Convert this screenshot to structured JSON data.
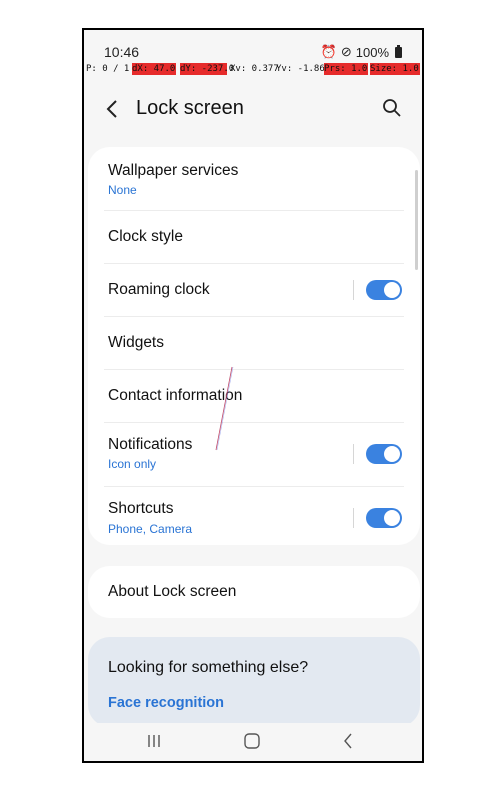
{
  "status": {
    "time": "10:46",
    "battery": "100%",
    "icons": [
      "alarm-icon",
      "do-not-disturb-icon",
      "battery-icon"
    ]
  },
  "debug": {
    "p": "P: 0 / 1",
    "dx": "dX: 47.0",
    "dy": "dY: -237.0",
    "xv": "Xv: 0.377",
    "yv": "Yv: -1.868",
    "prs": "Prs: 1.0",
    "size": "Size: 1.0"
  },
  "header": {
    "title": "Lock screen"
  },
  "settings": {
    "items": [
      {
        "label": "Wallpaper services",
        "sub": "None"
      },
      {
        "label": "Clock style"
      },
      {
        "label": "Roaming clock",
        "toggle": true
      },
      {
        "label": "Widgets"
      },
      {
        "label": "Contact information"
      },
      {
        "label": "Notifications",
        "sub": "Icon only",
        "toggle": true
      },
      {
        "label": "Shortcuts",
        "sub": "Phone, Camera",
        "toggle": true
      }
    ]
  },
  "about": {
    "label": "About Lock screen"
  },
  "suggestions": {
    "title": "Looking for something else?",
    "link": "Face recognition"
  },
  "colors": {
    "accent": "#3a82e0",
    "link": "#2a74d4",
    "debug_bg": "#e62b2b"
  }
}
